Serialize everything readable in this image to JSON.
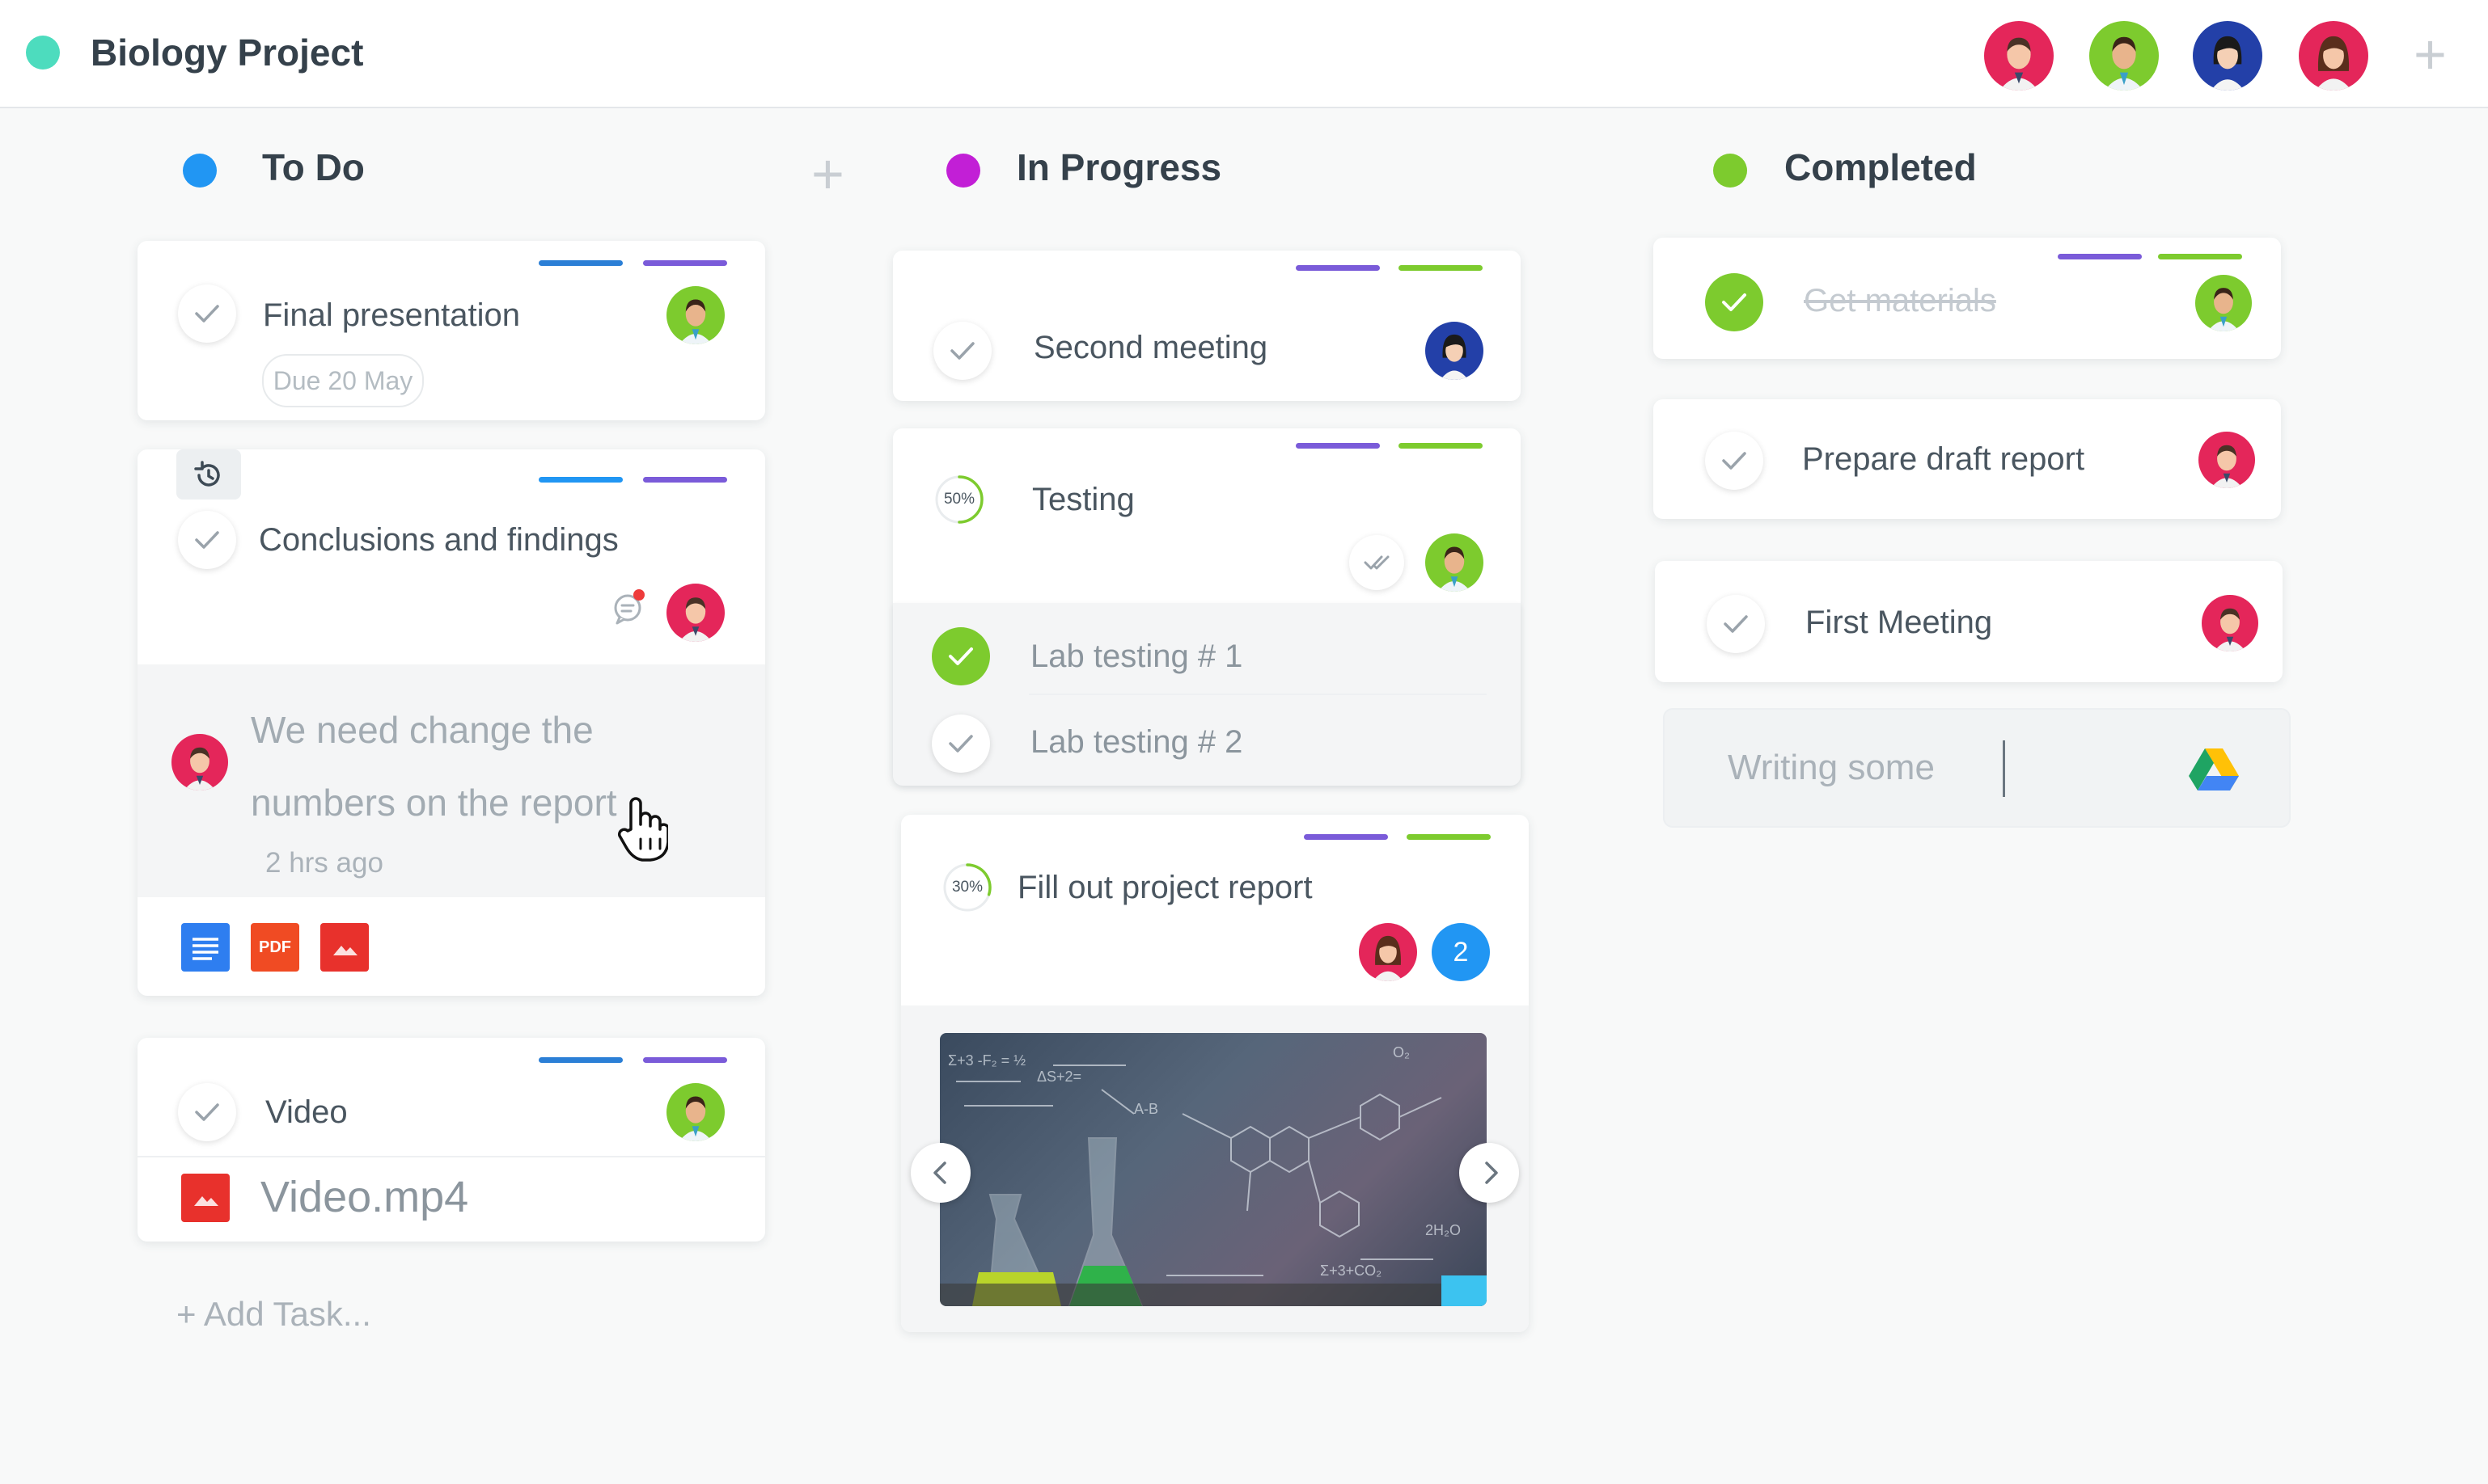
{
  "header": {
    "project_title": "Biology Project",
    "plus_glyph": "+"
  },
  "colors": {
    "project_dot": "#4ddcbe",
    "todo": "#2196f3",
    "in_progress": "#c21fd6",
    "completed": "#7dcb2e",
    "bar_blue": "#2b7fd6",
    "bar_purple": "#7a5bd9",
    "bar_green": "#7dcb2e"
  },
  "columns": {
    "todo": {
      "title": "To Do",
      "add_glyph": "+"
    },
    "in_progress": {
      "title": "In Progress"
    },
    "completed": {
      "title": "Completed"
    }
  },
  "todo": {
    "final_presentation": {
      "title": "Final presentation",
      "due": "Due 20 May"
    },
    "conclusions": {
      "title": "Conclusions and findings",
      "comment_text": "We need change the numbers on the report",
      "comment_time": "2 hrs ago",
      "attachments": [
        "doc",
        "PDF",
        "image"
      ]
    },
    "video": {
      "title": "Video",
      "file": "Video.mp4"
    },
    "add_task": "+ Add Task..."
  },
  "in_progress": {
    "second_meeting": {
      "title": "Second meeting"
    },
    "testing": {
      "title": "Testing",
      "progress_label": "50%",
      "progress": 0.5,
      "subtasks": [
        "Lab testing # 1",
        "Lab testing # 2"
      ]
    },
    "fill_out": {
      "title": "Fill out project report",
      "progress_label": "30%",
      "progress": 0.3,
      "count": "2"
    }
  },
  "completed": {
    "get_materials": {
      "title": "Get materials"
    },
    "prepare_draft": {
      "title": "Prepare draft report"
    },
    "first_meeting": {
      "title": "First Meeting"
    },
    "writing": {
      "text": "Writing some"
    }
  },
  "icons": [
    "check-icon",
    "history-icon",
    "comment-icon",
    "google-docs-icon",
    "pdf-icon",
    "image-icon",
    "google-drive-icon",
    "chevron-left-icon",
    "chevron-right-icon",
    "double-check-icon"
  ]
}
